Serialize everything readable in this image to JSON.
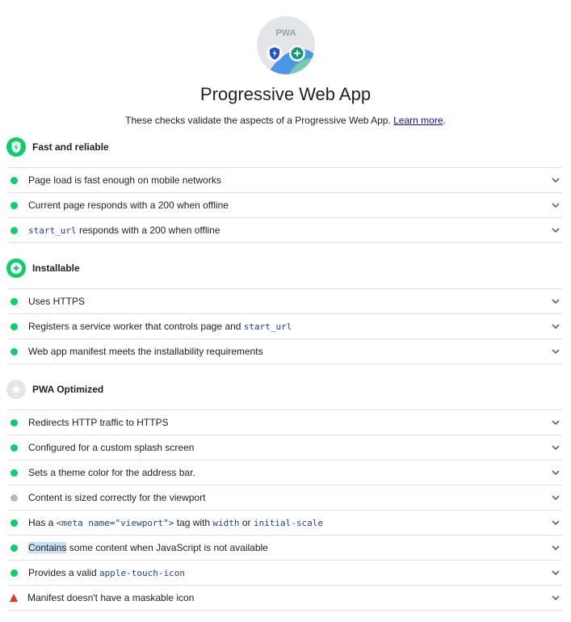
{
  "header": {
    "badge_text": "PWA",
    "title": "Progressive Web App",
    "description": "These checks validate the aspects of a Progressive Web App.",
    "learn_more": "Learn more",
    "period": "."
  },
  "colors": {
    "pass": "#0cce6b",
    "fail": "#eb3323",
    "na": "#b9b9b9",
    "code": "#1a3fa8",
    "link": "#1a0dab"
  },
  "groups": {
    "fast": {
      "title": "Fast and reliable",
      "items": [
        {
          "text": "Page load is fast enough on mobile networks"
        },
        {
          "text": "Current page responds with a 200 when offline"
        },
        {
          "code": "start_url",
          "text": " responds with a 200 when offline"
        }
      ]
    },
    "install": {
      "title": "Installable",
      "items": [
        {
          "text": "Uses HTTPS"
        },
        {
          "text": "Registers a service worker that controls page and ",
          "code": "start_url"
        },
        {
          "text": "Web app manifest meets the installability requirements"
        }
      ]
    },
    "optimized": {
      "title": "PWA Optimized",
      "items": [
        {
          "text": "Redirects HTTP traffic to HTTPS"
        },
        {
          "text": "Configured for a custom splash screen"
        },
        {
          "text": "Sets a theme color for the address bar."
        },
        {
          "text": "Content is sized correctly for the viewport"
        },
        {
          "p1": "Has a ",
          "c1": "<meta name=\"viewport\">",
          "p2": " tag with ",
          "c2": "width",
          "p3": " or ",
          "c3": "initial-scale"
        },
        {
          "highlight": "Contains",
          "text": " some content when JavaScript is not available"
        },
        {
          "text": "Provides a valid ",
          "code": "apple-touch-icon"
        },
        {
          "text": "Manifest doesn't have a maskable icon"
        }
      ]
    }
  }
}
